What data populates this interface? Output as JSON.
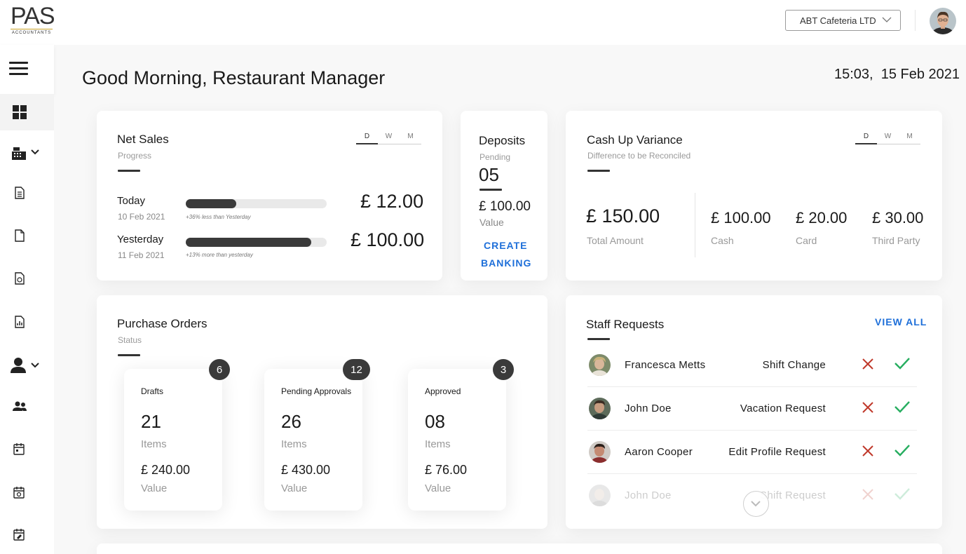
{
  "header": {
    "logo_text": "PAS",
    "logo_sub": "ACCOUNTANTS",
    "company": "ABT Cafeteria LTD",
    "avatar": "user-avatar"
  },
  "sidebar": {
    "icons": [
      "menu-icon",
      "dashboard-icon",
      "cash-register-icon",
      "chevron-down-icon",
      "document-icon",
      "file-icon",
      "money-file-icon",
      "report-icon",
      "user-icon",
      "chevron-down-icon",
      "users-icon",
      "calendar-icon",
      "calendar-clock-icon",
      "calendar-edit-icon"
    ]
  },
  "greeting": "Good Morning, Restaurant Manager",
  "datetime": "15:03,  15 Feb 2021",
  "net_sales": {
    "title": "Net Sales",
    "subtitle": "Progress",
    "tabs": [
      "D",
      "W",
      "M"
    ],
    "active_tab": "D",
    "rows": [
      {
        "label": "Today",
        "date": "10 Feb 2021",
        "note": "+36% less than Yesterday",
        "amount": "£ 12.00",
        "progress": 0.36
      },
      {
        "label": "Yesterday",
        "date": "11 Feb 2021",
        "note": "+13% more than yesterday",
        "amount": "£ 100.00",
        "progress": 0.89
      }
    ]
  },
  "deposits": {
    "title": "Deposits",
    "pending_label": "Pending",
    "pending_count": "05",
    "value": "£ 100.00",
    "value_label": "Value",
    "action_line1": "CREATE",
    "action_line2": "BANKING"
  },
  "cash_up": {
    "title": "Cash Up Variance",
    "subtitle": "Difference to be Reconciled",
    "tabs": [
      "D",
      "W",
      "M"
    ],
    "active_tab": "D",
    "total": "£ 150.00",
    "total_label": "Total Amount",
    "items": [
      {
        "amount": "£ 100.00",
        "label": "Cash"
      },
      {
        "amount": "£ 20.00",
        "label": "Card"
      },
      {
        "amount": "£ 30.00",
        "label": "Third Party"
      }
    ]
  },
  "purchase_orders": {
    "title": "Purchase Orders",
    "subtitle": "Status",
    "boxes": [
      {
        "label": "Drafts",
        "badge": "6",
        "count": "21",
        "count_label": "Items",
        "value": "£ 240.00",
        "value_label": "Value"
      },
      {
        "label": "Pending Approvals",
        "badge": "12",
        "count": "26",
        "count_label": "Items",
        "value": "£ 430.00",
        "value_label": "Value"
      },
      {
        "label": "Approved",
        "badge": "3",
        "count": "08",
        "count_label": "Items",
        "value": "£ 76.00",
        "value_label": "Value"
      }
    ]
  },
  "staff_requests": {
    "title": "Staff Requests",
    "view_all": "VIEW ALL",
    "rows": [
      {
        "name": "Francesca Metts",
        "type": "Shift Change"
      },
      {
        "name": "John Doe",
        "type": "Vacation Request"
      },
      {
        "name": "Aaron Cooper",
        "type": "Edit Profile Request"
      },
      {
        "name": "John Doe",
        "type": "Shift Request"
      }
    ]
  },
  "colors": {
    "accent_blue": "#1e6fd9",
    "reject_red": "#c0392b",
    "approve_green": "#27ae60",
    "dark": "#3a3a3a"
  }
}
